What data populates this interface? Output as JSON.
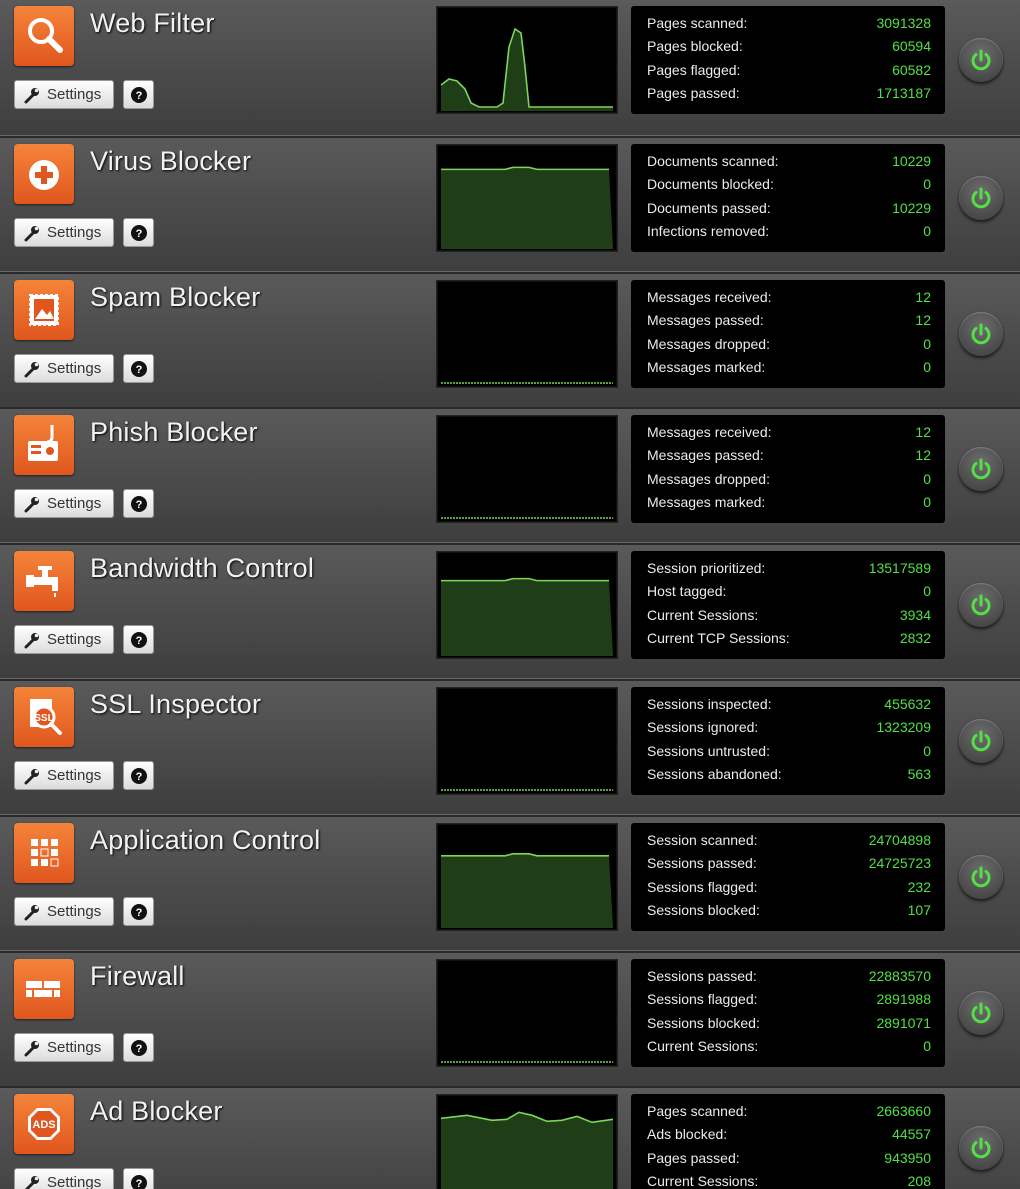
{
  "ui": {
    "settings_label": "Settings",
    "accent_color": "#52e045",
    "icon_color": "#e0561e",
    "graph_fill": "#1f3d17",
    "graph_line": "#7bd65a"
  },
  "apps": [
    {
      "name": "Web Filter",
      "icon": "magnifier-icon",
      "metrics": [
        {
          "label": "Pages scanned:",
          "value": "3091328"
        },
        {
          "label": "Pages blocked:",
          "value": "60594"
        },
        {
          "label": "Pages flagged:",
          "value": "60582"
        },
        {
          "label": "Pages passed:",
          "value": "1713187"
        }
      ]
    },
    {
      "name": "Virus Blocker",
      "icon": "plus-shield-icon",
      "metrics": [
        {
          "label": "Documents scanned:",
          "value": "10229"
        },
        {
          "label": "Documents blocked:",
          "value": "0"
        },
        {
          "label": "Documents passed:",
          "value": "10229"
        },
        {
          "label": "Infections removed:",
          "value": "0"
        }
      ]
    },
    {
      "name": "Spam Blocker",
      "icon": "stamp-icon",
      "metrics": [
        {
          "label": "Messages received:",
          "value": "12"
        },
        {
          "label": "Messages passed:",
          "value": "12"
        },
        {
          "label": "Messages dropped:",
          "value": "0"
        },
        {
          "label": "Messages marked:",
          "value": "0"
        }
      ]
    },
    {
      "name": "Phish Blocker",
      "icon": "id-card-hook-icon",
      "metrics": [
        {
          "label": "Messages received:",
          "value": "12"
        },
        {
          "label": "Messages passed:",
          "value": "12"
        },
        {
          "label": "Messages dropped:",
          "value": "0"
        },
        {
          "label": "Messages marked:",
          "value": "0"
        }
      ]
    },
    {
      "name": "Bandwidth Control",
      "icon": "faucet-icon",
      "metrics": [
        {
          "label": "Session prioritized:",
          "value": "13517589"
        },
        {
          "label": "Host tagged:",
          "value": "0"
        },
        {
          "label": "Current Sessions:",
          "value": "3934"
        },
        {
          "label": "Current TCP Sessions:",
          "value": "2832"
        }
      ]
    },
    {
      "name": "SSL Inspector",
      "icon": "ssl-magnifier-icon",
      "metrics": [
        {
          "label": "Sessions inspected:",
          "value": "455632"
        },
        {
          "label": "Sessions ignored:",
          "value": "1323209"
        },
        {
          "label": "Sessions untrusted:",
          "value": "0"
        },
        {
          "label": "Sessions abandoned:",
          "value": "563"
        }
      ]
    },
    {
      "name": "Application Control",
      "icon": "grid-icon",
      "metrics": [
        {
          "label": "Session scanned:",
          "value": "24704898"
        },
        {
          "label": "Sessions passed:",
          "value": "24725723"
        },
        {
          "label": "Sessions flagged:",
          "value": "232"
        },
        {
          "label": "Sessions blocked:",
          "value": "107"
        }
      ]
    },
    {
      "name": "Firewall",
      "icon": "brick-wall-icon",
      "metrics": [
        {
          "label": "Sessions passed:",
          "value": "22883570"
        },
        {
          "label": "Sessions flagged:",
          "value": "2891988"
        },
        {
          "label": "Sessions blocked:",
          "value": "2891071"
        },
        {
          "label": "Current Sessions:",
          "value": "0"
        }
      ]
    },
    {
      "name": "Ad Blocker",
      "icon": "ads-octagon-icon",
      "metrics": [
        {
          "label": "Pages scanned:",
          "value": "2663660"
        },
        {
          "label": "Ads blocked:",
          "value": "44557"
        },
        {
          "label": "Pages passed:",
          "value": "943950"
        },
        {
          "label": "Current Sessions:",
          "value": "208"
        }
      ]
    }
  ]
}
